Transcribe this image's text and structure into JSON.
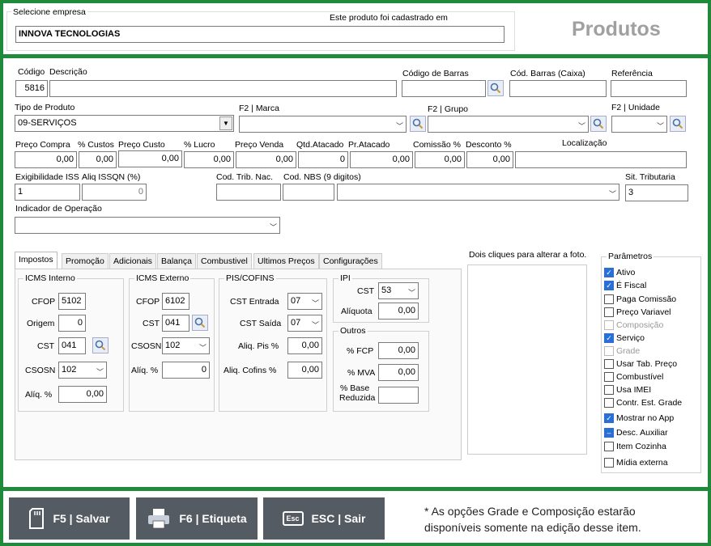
{
  "header": {
    "company_label": "Selecione empresa",
    "registered_label": "Este produto foi cadastrado em",
    "company_value": "INNOVA TECNOLOGIAS",
    "page_title": "Produtos"
  },
  "form": {
    "codigo_label": "Código",
    "codigo_value": "5816",
    "descricao_label": "Descrição",
    "descricao_value": "",
    "codigo_barras_label": "Código de Barras",
    "cod_barras_caixa_label": "Cód. Barras (Caixa)",
    "referencia_label": "Referência",
    "tipo_produto_label": "Tipo de Produto",
    "tipo_produto_value": "09-SERVIÇOS",
    "marca_label": "F2 | Marca",
    "grupo_label": "F2 | Grupo",
    "unidade_label": "F2 | Unidade",
    "preco_compra_label": "Preço Compra",
    "preco_compra_value": "0,00",
    "custos_label": "% Custos",
    "custos_value": "0,00",
    "preco_custo_label": "Preço Custo",
    "preco_custo_value": "0,00",
    "lucro_label": "% Lucro",
    "lucro_value": "0,00",
    "preco_venda_label": "Preço Venda",
    "preco_venda_value": "0,00",
    "qtd_atacado_label": "Qtd.Atacado",
    "qtd_atacado_value": "0",
    "pr_atacado_label": "Pr.Atacado",
    "pr_atacado_value": "0,00",
    "comissao_label": "Comissão %",
    "comissao_value": "0,00",
    "desconto_label": "Desconto %",
    "desconto_value": "0,00",
    "localizacao_label": "Localização",
    "exig_iss_label": "Exigibilidade ISS",
    "exig_iss_value": "1",
    "aliq_issqn_label": "Aliq ISSQN (%)",
    "aliq_issqn_value": "0",
    "cod_trib_label": "Cod. Trib. Nac.",
    "cod_nbs_label": "Cod. NBS (9 digitos)",
    "sit_trib_label": "Sit. Tributaria",
    "sit_trib_value": "3",
    "ind_operacao_label": "Indicador de Operação"
  },
  "tabs": [
    "Impostos",
    "Promoção",
    "Adicionais",
    "Balança",
    "Combustivel",
    "Ultimos Preços",
    "Configurações"
  ],
  "impostos": {
    "icms_interno": {
      "title": "ICMS Interno",
      "cfop_label": "CFOP",
      "cfop_value": "5102",
      "origem_label": "Origem",
      "origem_value": "0",
      "cst_label": "CST",
      "cst_value": "041",
      "csosn_label": "CSOSN",
      "csosn_value": "102",
      "aliq_label": "Alíq. %",
      "aliq_value": "0,00"
    },
    "icms_externo": {
      "title": "ICMS Externo",
      "cfop_label": "CFOP",
      "cfop_value": "6102",
      "cst_label": "CST",
      "cst_value": "041",
      "csosn_label": "CSOSN",
      "csosn_value": "102",
      "aliq_label": "Alíq. %",
      "aliq_value": "0"
    },
    "pis_cofins": {
      "title": "PIS/COFINS",
      "cst_entrada_label": "CST Entrada",
      "cst_entrada_value": "07",
      "cst_saida_label": "CST Saída",
      "cst_saida_value": "07",
      "aliq_pis_label": "Aliq. Pis %",
      "aliq_pis_value": "0,00",
      "aliq_cofins_label": "Aliq. Cofins %",
      "aliq_cofins_value": "0,00"
    },
    "ipi": {
      "title": "IPI",
      "cst_label": "CST",
      "cst_value": "53",
      "aliquota_label": "Alíquota",
      "aliquota_value": "0,00"
    },
    "outros": {
      "title": "Outros",
      "fcp_label": "% FCP",
      "fcp_value": "0,00",
      "mva_label": "% MVA",
      "mva_value": "0,00",
      "base_label_1": "% Base",
      "base_label_2": "Reduzida",
      "base_value": ""
    }
  },
  "photo_label": "Dois cliques para alterar a foto.",
  "parametros": {
    "title": "Parâmetros",
    "items": [
      {
        "label": "Ativo",
        "state": "checked"
      },
      {
        "label": "É Fiscal",
        "state": "checked"
      },
      {
        "label": "Paga Comissão",
        "state": "unchecked"
      },
      {
        "label": "Preço Variavel",
        "state": "unchecked"
      },
      {
        "label": "Composição",
        "state": "disabled"
      },
      {
        "label": "Serviço",
        "state": "checked"
      },
      {
        "label": "Grade",
        "state": "disabled"
      },
      {
        "label": "Usar Tab. Preço",
        "state": "unchecked"
      },
      {
        "label": "Combustível",
        "state": "unchecked"
      },
      {
        "label": "Usa IMEI",
        "state": "unchecked"
      },
      {
        "label": "Contr. Est. Grade",
        "state": "unchecked"
      },
      {
        "label": "Mostrar no App",
        "state": "checked"
      },
      {
        "label": "Desc. Auxiliar",
        "state": "indeterminate"
      },
      {
        "label": "Item Cozinha",
        "state": "unchecked"
      },
      {
        "label": "Mídia externa",
        "state": "unchecked"
      }
    ]
  },
  "footer": {
    "save_label": "F5 | Salvar",
    "label_label": "F6 | Etiqueta",
    "exit_label": "ESC | Sair",
    "esc_key": "Esc",
    "note": "* As opções Grade e Composição estarão disponíveis somente na edição desse item."
  },
  "colors": {
    "frame_green": "#1e8a3a",
    "button_gray": "#555b62",
    "title_gray": "#a0a0a0",
    "check_blue": "#2a6fd6"
  }
}
